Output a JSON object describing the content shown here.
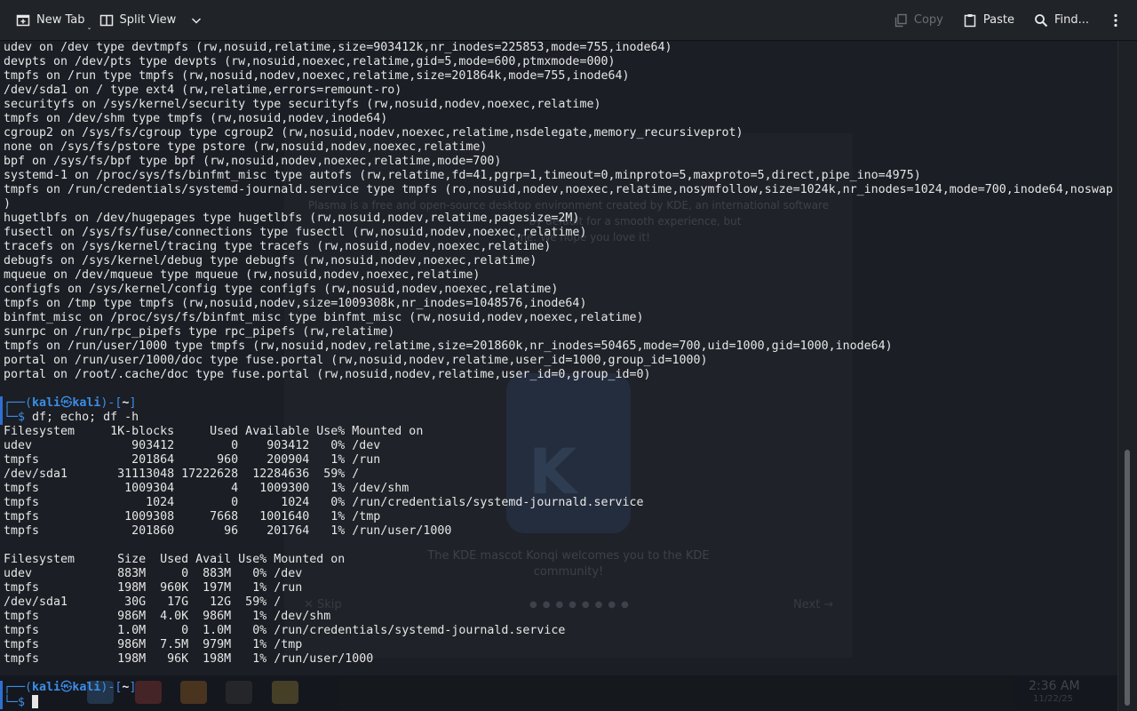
{
  "toolbar": {
    "new_tab": "New Tab",
    "split_view": "Split View",
    "copy": "Copy",
    "paste": "Paste",
    "find": "Find..."
  },
  "background": {
    "welcome_line1": "Plasma is a free and open-source desktop environment created by KDE, an international software",
    "welcome_line2": "by default for a smooth experience, but",
    "welcome_line3": "one. We hope you love it!",
    "mascot_line1": "The KDE mascot Konqi welcomes you to the KDE",
    "mascot_line2": "community!",
    "skip": "Skip",
    "next": "Next",
    "clock": "2:36 AM",
    "date": "11/22/25"
  },
  "terminal": {
    "mount_output": [
      "udev on /dev type devtmpfs (rw,nosuid,relatime,size=903412k,nr_inodes=225853,mode=755,inode64)",
      "devpts on /dev/pts type devpts (rw,nosuid,noexec,relatime,gid=5,mode=600,ptmxmode=000)",
      "tmpfs on /run type tmpfs (rw,nosuid,nodev,noexec,relatime,size=201864k,mode=755,inode64)",
      "/dev/sda1 on / type ext4 (rw,relatime,errors=remount-ro)",
      "securityfs on /sys/kernel/security type securityfs (rw,nosuid,nodev,noexec,relatime)",
      "tmpfs on /dev/shm type tmpfs (rw,nosuid,nodev,inode64)",
      "cgroup2 on /sys/fs/cgroup type cgroup2 (rw,nosuid,nodev,noexec,relatime,nsdelegate,memory_recursiveprot)",
      "none on /sys/fs/pstore type pstore (rw,nosuid,nodev,noexec,relatime)",
      "bpf on /sys/fs/bpf type bpf (rw,nosuid,nodev,noexec,relatime,mode=700)",
      "systemd-1 on /proc/sys/fs/binfmt_misc type autofs (rw,relatime,fd=41,pgrp=1,timeout=0,minproto=5,maxproto=5,direct,pipe_ino=4975)",
      "tmpfs on /run/credentials/systemd-journald.service type tmpfs (ro,nosuid,nodev,noexec,relatime,nosymfollow,size=1024k,nr_inodes=1024,mode=700,inode64,noswap",
      ")",
      "hugetlbfs on /dev/hugepages type hugetlbfs (rw,nosuid,nodev,relatime,pagesize=2M)",
      "fusectl on /sys/fs/fuse/connections type fusectl (rw,nosuid,nodev,noexec,relatime)",
      "tracefs on /sys/kernel/tracing type tracefs (rw,nosuid,nodev,noexec,relatime)",
      "debugfs on /sys/kernel/debug type debugfs (rw,nosuid,nodev,noexec,relatime)",
      "mqueue on /dev/mqueue type mqueue (rw,nosuid,nodev,noexec,relatime)",
      "configfs on /sys/kernel/config type configfs (rw,nosuid,nodev,noexec,relatime)",
      "tmpfs on /tmp type tmpfs (rw,nosuid,nodev,size=1009308k,nr_inodes=1048576,inode64)",
      "binfmt_misc on /proc/sys/fs/binfmt_misc type binfmt_misc (rw,nosuid,nodev,noexec,relatime)",
      "sunrpc on /run/rpc_pipefs type rpc_pipefs (rw,relatime)",
      "tmpfs on /run/user/1000 type tmpfs (rw,nosuid,nodev,relatime,size=201860k,nr_inodes=50465,mode=700,uid=1000,gid=1000,inode64)",
      "portal on /run/user/1000/doc type fuse.portal (rw,nosuid,nodev,relatime,user_id=1000,group_id=1000)",
      "portal on /root/.cache/doc type fuse.portal (rw,nosuid,nodev,relatime,user_id=0,group_id=0)"
    ],
    "prompt": {
      "frame_top_open": "┌──(",
      "user": "kali",
      "skull": "㉿",
      "host": "kali",
      "frame_mid": ")-[",
      "path": "~",
      "frame_close": "]",
      "frame_bottom": "└─",
      "dollar": "$ "
    },
    "command": "df; echo; df -h",
    "df_output": [
      "Filesystem     1K-blocks     Used Available Use% Mounted on",
      "udev              903412        0    903412   0% /dev",
      "tmpfs             201864      960    200904   1% /run",
      "/dev/sda1       31113048 17222628  12284636  59% /",
      "tmpfs            1009304        4   1009300   1% /dev/shm",
      "tmpfs               1024        0      1024   0% /run/credentials/systemd-journald.service",
      "tmpfs            1009308     7668   1001640   1% /tmp",
      "tmpfs             201860       96    201764   1% /run/user/1000"
    ],
    "dfh_output": [
      "Filesystem      Size  Used Avail Use% Mounted on",
      "udev            883M     0  883M   0% /dev",
      "tmpfs           198M  960K  197M   1% /run",
      "/dev/sda1        30G   17G   12G  59% /",
      "tmpfs           986M  4.0K  986M   1% /dev/shm",
      "tmpfs           1.0M     0  1.0M   0% /run/credentials/systemd-journald.service",
      "tmpfs           986M  7.5M  979M   1% /tmp",
      "tmpfs           198M   96K  198M   1% /run/user/1000"
    ]
  },
  "colors": {
    "prompt_blue": "#3b8eea",
    "terminal_bg": "#1b1e24",
    "text": "#e6e6e6"
  }
}
